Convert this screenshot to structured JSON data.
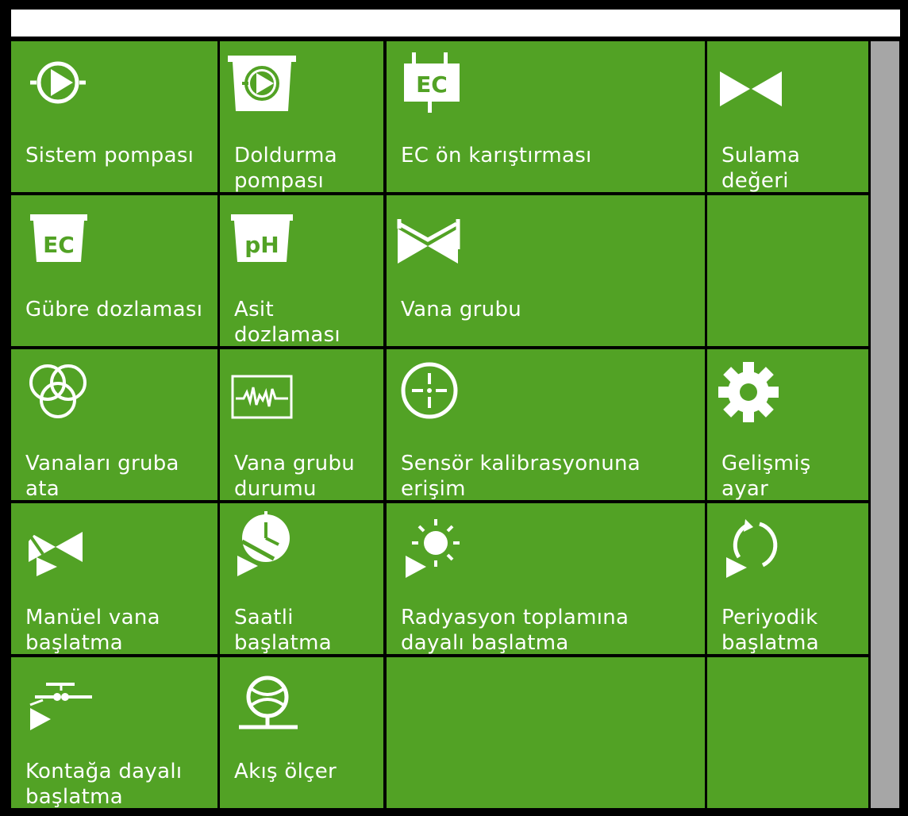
{
  "colors": {
    "tile": "#52a225",
    "frame": "#000000",
    "titlebar": "#ffffff",
    "scrollbar": "#a6a6a6",
    "icon": "#ffffff"
  },
  "tiles": [
    {
      "label": "Sistem pompası",
      "icon": "pump-icon"
    },
    {
      "label": "Doldurma\npompası",
      "icon": "filling-pump-icon"
    },
    {
      "label": "EC ön karıştırması",
      "icon": "ec-premix-icon",
      "icon_text": "EC"
    },
    {
      "label": "Sulama\ndeğeri",
      "icon": "valve-icon"
    },
    {
      "label": "Gübre dozlaması",
      "icon": "ec-dosing-icon",
      "icon_text": "EC"
    },
    {
      "label": "Asit\ndozlaması",
      "icon": "ph-dosing-icon",
      "icon_text": "pH"
    },
    {
      "label": "Vana grubu",
      "icon": "valve-group-icon"
    },
    {
      "label": "",
      "icon": ""
    },
    {
      "label": "Vanaları gruba\nata",
      "icon": "assign-valves-icon"
    },
    {
      "label": "Vana grubu\ndurumu",
      "icon": "valve-group-status-icon"
    },
    {
      "label": "Sensör kalibrasyonuna\nerişim",
      "icon": "sensor-calibration-icon"
    },
    {
      "label": "Gelişmiş\nayar",
      "icon": "gear-icon"
    },
    {
      "label": "Manüel vana\nbaşlatma",
      "icon": "manual-valve-start-icon"
    },
    {
      "label": "Saatli\nbaşlatma",
      "icon": "timed-start-icon"
    },
    {
      "label": "Radyasyon toplamına\ndayalı başlatma",
      "icon": "radiation-start-icon"
    },
    {
      "label": "Periyodik\nbaşlatma",
      "icon": "periodic-start-icon"
    },
    {
      "label": "Kontağa dayalı\nbaşlatma",
      "icon": "contact-start-icon"
    },
    {
      "label": "Akış ölçer",
      "icon": "flow-meter-icon"
    },
    {
      "label": "",
      "icon": ""
    },
    {
      "label": "",
      "icon": ""
    }
  ]
}
